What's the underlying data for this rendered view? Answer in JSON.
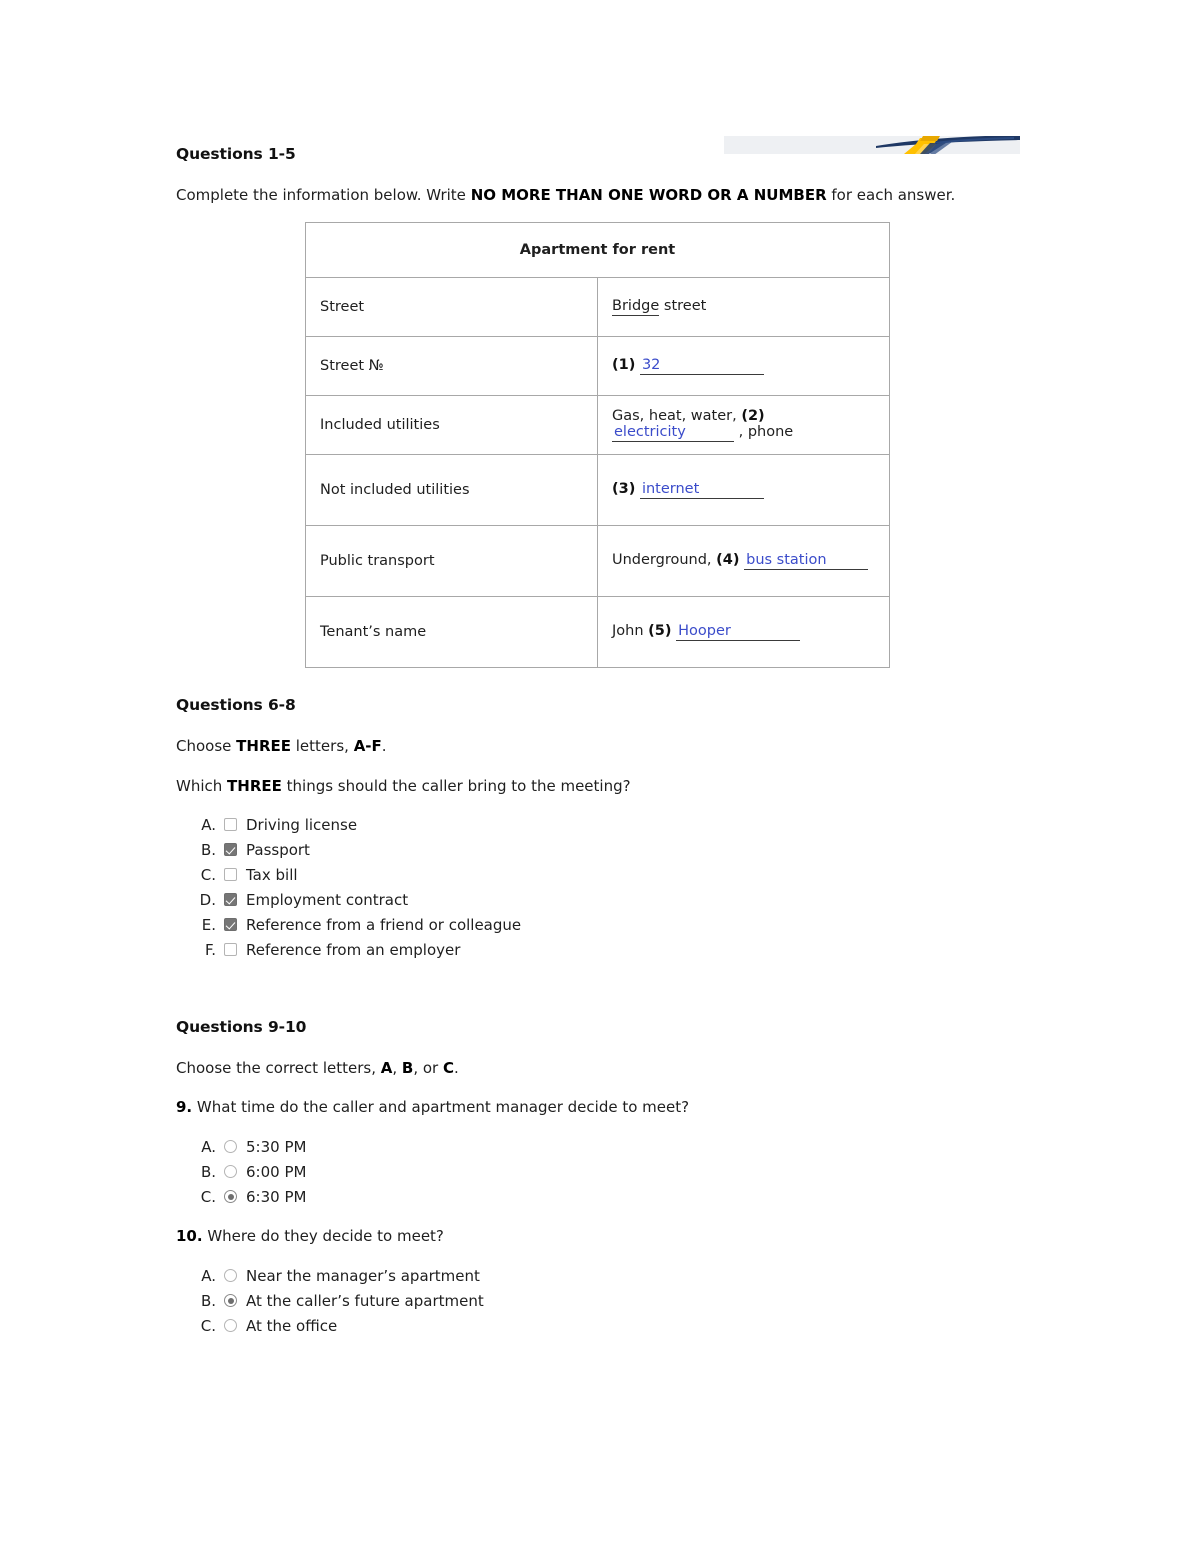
{
  "logo": {
    "alt": "institution-logo-banner"
  },
  "sections": [
    {
      "heading": "Questions 1-5",
      "instruction_prefix": "Complete the information below. Write ",
      "instruction_bold": "NO MORE THAN ONE WORD OR A NUMBER",
      "instruction_suffix": " for each answer."
    }
  ],
  "table": {
    "title": "Apartment for rent",
    "rows": [
      {
        "label": "Street",
        "value_prefix": "",
        "number": "",
        "answer": "Bridge",
        "value_suffix": " street",
        "answer_style": "example"
      },
      {
        "label": "Street №",
        "value_prefix": "",
        "number": "(1)",
        "answer": "32",
        "value_suffix": "",
        "answer_style": "filled"
      },
      {
        "label": "Included utilities",
        "value_prefix": "Gas, heat, water, ",
        "number": "(2)",
        "answer": "electricity",
        "value_suffix": " , phone",
        "answer_style": "filled"
      },
      {
        "label": "Not included utilities",
        "value_prefix": "",
        "number": "(3)",
        "answer": "internet",
        "value_suffix": "",
        "answer_style": "filled"
      },
      {
        "label": "Public transport",
        "value_prefix": "Underground, ",
        "number": "(4)",
        "answer": "bus station",
        "value_suffix": "",
        "answer_style": "filled"
      },
      {
        "label": "Tenant’s name",
        "value_prefix": "John ",
        "number": "(5)",
        "answer": "Hooper",
        "value_suffix": "",
        "answer_style": "filled"
      }
    ]
  },
  "questions_6_8": {
    "heading": "Questions 6-8",
    "instruction_1_pre": "Choose ",
    "instruction_1_bold": "THREE",
    "instruction_1_mid": " letters, ",
    "instruction_1_bold2": "A-F",
    "instruction_1_post": ".",
    "prompt_pre": "Which ",
    "prompt_bold": "THREE",
    "prompt_post": " things should the caller bring to the meeting?",
    "options": [
      {
        "letter": "A.",
        "label": "Driving license",
        "checked": false
      },
      {
        "letter": "B.",
        "label": "Passport",
        "checked": true
      },
      {
        "letter": "C.",
        "label": "Tax bill",
        "checked": false
      },
      {
        "letter": "D.",
        "label": "Employment contract",
        "checked": true
      },
      {
        "letter": "E.",
        "label": "Reference from a friend or colleague",
        "checked": true
      },
      {
        "letter": "F.",
        "label": "Reference from an employer",
        "checked": false
      }
    ]
  },
  "questions_9_10": {
    "heading": "Questions 9-10",
    "instruction_pre": "Choose the correct letters, ",
    "instruction_a": "A",
    "instruction_sep1": ", ",
    "instruction_b": "B",
    "instruction_sep2": ", or ",
    "instruction_c": "C",
    "instruction_end": ".",
    "q9": {
      "number": "9.",
      "text": " What time do the caller and apartment manager decide to meet?",
      "options": [
        {
          "letter": "A.",
          "label": "5:30 PM",
          "selected": false
        },
        {
          "letter": "B.",
          "label": "6:00 PM",
          "selected": false
        },
        {
          "letter": "C.",
          "label": "6:30 PM",
          "selected": true
        }
      ]
    },
    "q10": {
      "number": "10.",
      "text": " Where do they decide to meet?",
      "options": [
        {
          "letter": "A.",
          "label": "Near the manager’s apartment",
          "selected": false
        },
        {
          "letter": "B.",
          "label": "At the caller’s future apartment",
          "selected": true
        },
        {
          "letter": "C.",
          "label": "At the office",
          "selected": false
        }
      ]
    }
  },
  "colors": {
    "answer_blue": "#3b4cca",
    "checkbox_on": "#767676",
    "table_border": "#a8a8a8",
    "logo_navy": "#1f3864",
    "logo_gold": "#ffc000"
  }
}
